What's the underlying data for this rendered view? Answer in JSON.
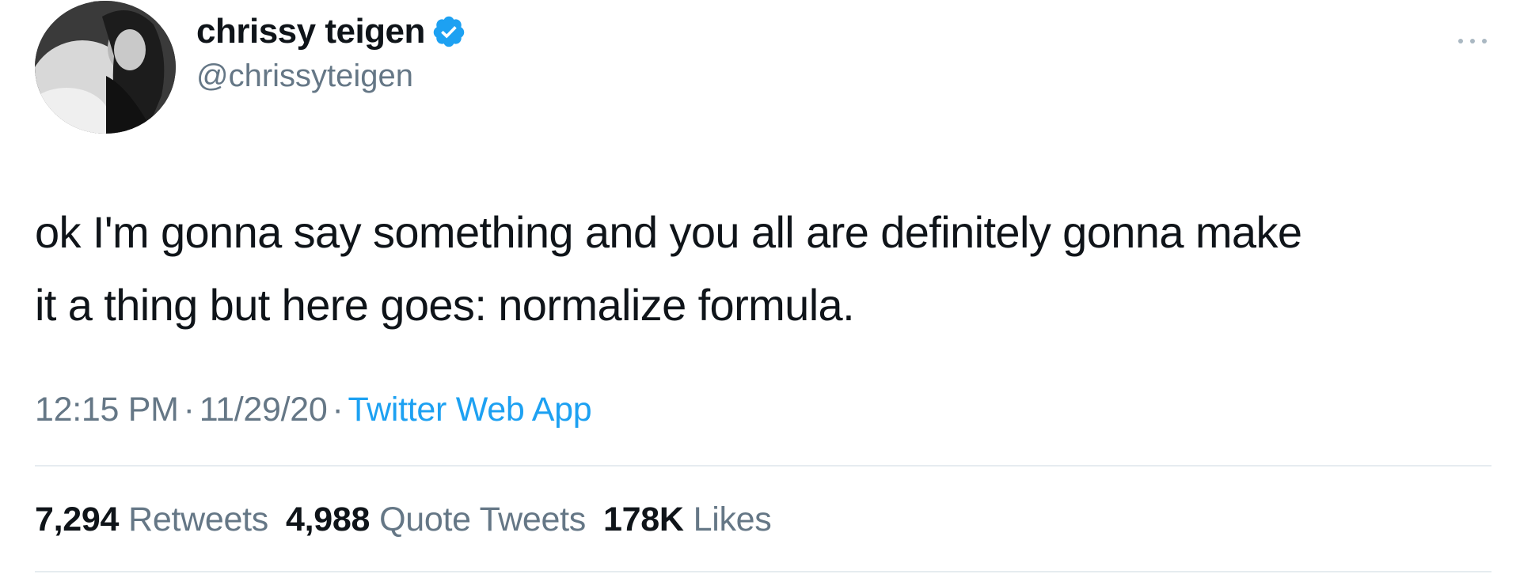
{
  "user": {
    "display_name": "chrissy teigen",
    "handle": "@chrissyteigen",
    "verified": true,
    "avatar_icon": "profile-photo"
  },
  "tweet": {
    "text": "ok I'm gonna say something and you all are definitely gonna make\nit a thing but here goes: normalize formula."
  },
  "meta": {
    "time": "12:15 PM",
    "separator": "·",
    "date": "11/29/20",
    "source": "Twitter Web App"
  },
  "stats": {
    "retweets_count": "7,294",
    "retweets_label": "Retweets",
    "quote_tweets_count": "4,988",
    "quote_tweets_label": "Quote Tweets",
    "likes_count": "178K",
    "likes_label": "Likes"
  },
  "icons": {
    "verified": "verified-badge-icon",
    "more": "more-options-icon"
  },
  "colors": {
    "accent": "#1da1f2",
    "text": "#0f1419",
    "secondary_text": "#657786",
    "divider": "#e6ecf0"
  }
}
